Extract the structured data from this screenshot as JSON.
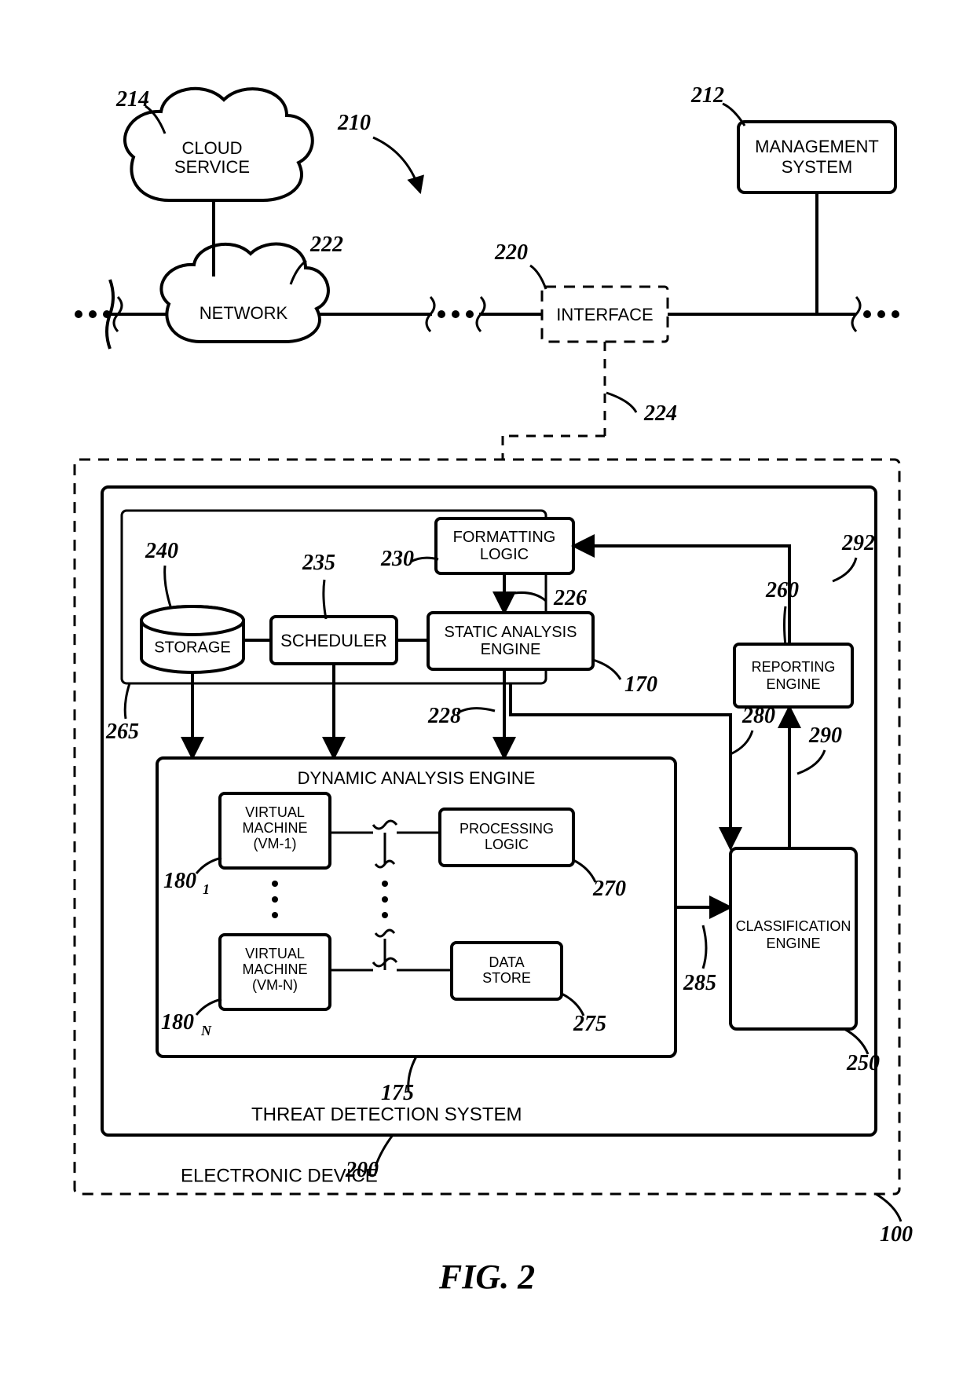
{
  "figure_label": "FIG. 2",
  "top": {
    "cloud_service": "CLOUD\nSERVICE",
    "network": "NETWORK",
    "interface": "INTERFACE",
    "management_system": "MANAGEMENT\nSYSTEM"
  },
  "labels": {
    "electronic_device": "ELECTRONIC DEVICE",
    "threat_detection_system": "THREAT DETECTION SYSTEM",
    "formatting_logic": "FORMATTING\nLOGIC",
    "static_analysis_engine": "STATIC ANALYSIS\nENGINE",
    "scheduler": "SCHEDULER",
    "storage": "STORAGE",
    "dynamic_analysis_engine": "DYNAMIC ANALYSIS ENGINE",
    "vm1": "VIRTUAL\nMACHINE\n(VM-1)",
    "vmn": "VIRTUAL\nMACHINE\n(VM-N)",
    "processing_logic": "PROCESSING\nLOGIC",
    "data_store": "DATA\nSTORE",
    "classification_engine": "CLASSIFICATION\nENGINE",
    "reporting_engine": "REPORTING\nENGINE"
  },
  "refs": {
    "r100": "100",
    "r170": "170",
    "r175": "175",
    "r180_1": "180",
    "r180_1_sub": "1",
    "r180_n": "180",
    "r180_n_sub": "N",
    "r200": "200",
    "r210": "210",
    "r212": "212",
    "r214": "214",
    "r220": "220",
    "r222": "222",
    "r224": "224",
    "r226": "226",
    "r228": "228",
    "r230": "230",
    "r235": "235",
    "r240": "240",
    "r250": "250",
    "r260": "260",
    "r265": "265",
    "r270": "270",
    "r275": "275",
    "r280": "280",
    "r285": "285",
    "r290": "290",
    "r292": "292"
  }
}
